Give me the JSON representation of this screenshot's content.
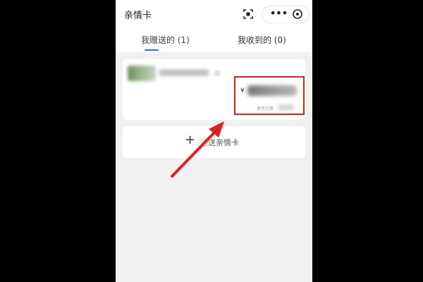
{
  "header": {
    "title": "亲情卡",
    "more_label": "•••"
  },
  "tabs": [
    {
      "label": "我赠送的 (1)",
      "active": true
    },
    {
      "label": "我收到的 (0)",
      "active": false
    }
  ],
  "card": {
    "currency_symbol": "¥",
    "month_label": "本月已用"
  },
  "gift_button": {
    "label": "赠送亲情卡"
  },
  "colors": {
    "accent": "#1677ff",
    "highlight_red": "#e01f1f",
    "page_bg": "#f1f1f1"
  },
  "icons": [
    "scan-icon",
    "more-icon",
    "close-icon",
    "plus-icon",
    "red-arrow"
  ]
}
